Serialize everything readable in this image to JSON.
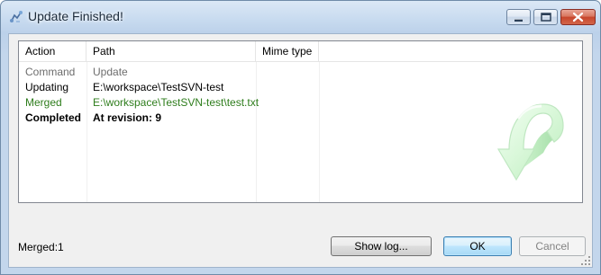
{
  "window": {
    "title": "Update Finished!",
    "icon": "tortoisesvn-app-icon",
    "controls": [
      "minimize-icon",
      "maximize-icon",
      "close-icon"
    ]
  },
  "list": {
    "columns": [
      "Action",
      "Path",
      "Mime type"
    ],
    "rows": [
      {
        "action": "Command",
        "path": "Update",
        "style": "command"
      },
      {
        "action": "Updating",
        "path": "E:\\workspace\\TestSVN-test",
        "style": "normal"
      },
      {
        "action": "Merged",
        "path": "E:\\workspace\\TestSVN-test\\test.txt",
        "style": "merged"
      },
      {
        "action": "Completed",
        "path": "At revision: 9",
        "style": "bold"
      }
    ],
    "graphic": "update-arrow-icon"
  },
  "status": {
    "text": "Merged:1"
  },
  "buttons": {
    "show_log": "Show log...",
    "ok": "OK",
    "cancel": "Cancel"
  },
  "colors": {
    "merged_text": "#2e7d1c",
    "command_text": "#6d6d6d",
    "arrow_fill": "#d8f7d8"
  }
}
